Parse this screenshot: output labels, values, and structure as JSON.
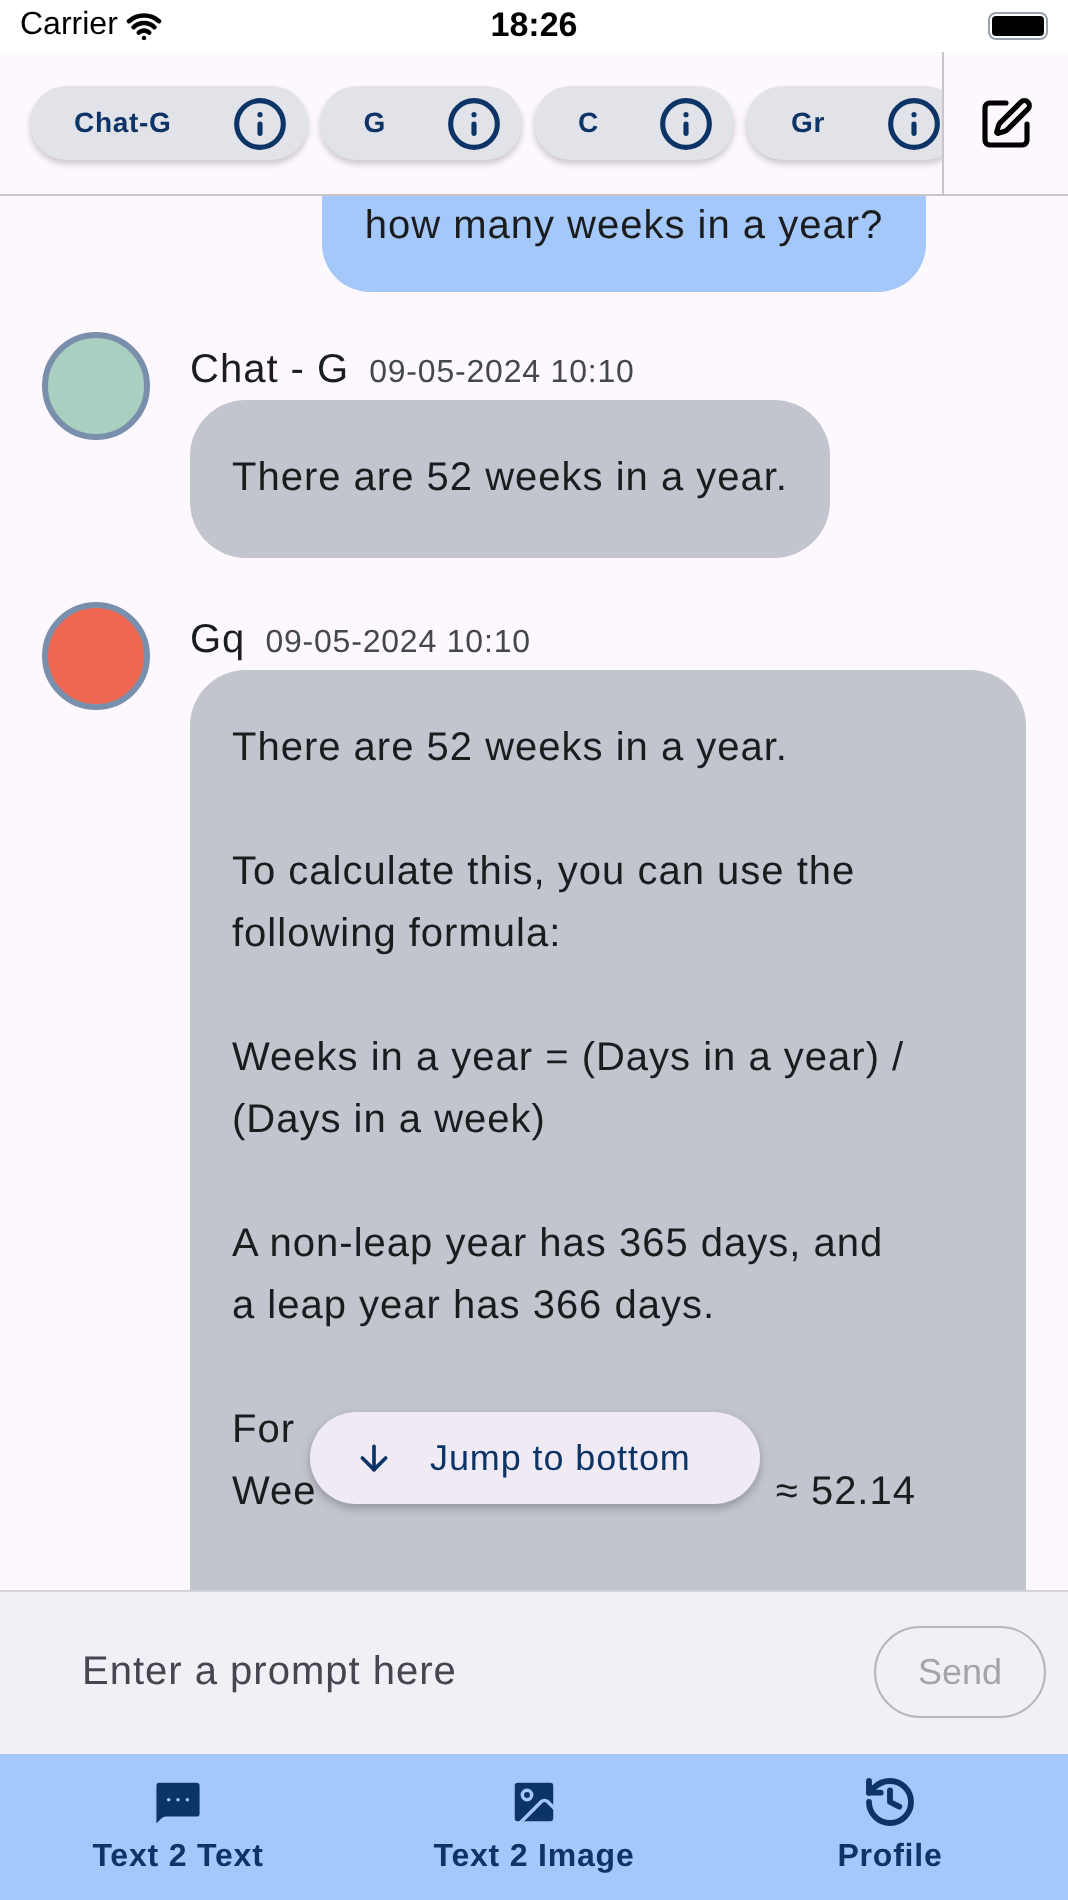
{
  "status_bar": {
    "carrier": "Carrier",
    "time": "18:26"
  },
  "models": [
    {
      "label": "Chat-G"
    },
    {
      "label": "G"
    },
    {
      "label": "C"
    },
    {
      "label": "Gr"
    }
  ],
  "messages": [
    {
      "kind": "user",
      "text": "how many weeks in a year?"
    },
    {
      "kind": "bot",
      "name": "Chat - G",
      "time": "09-05-2024 10:10",
      "color": "#a9cfc0",
      "paragraphs": [
        [
          "There are 52 weeks in a year."
        ]
      ]
    },
    {
      "kind": "bot",
      "name": "Gq",
      "time": "09-05-2024 10:10",
      "color": "#ee6650",
      "paragraphs": [
        [
          "There are 52 weeks in a year."
        ],
        [
          "To calculate this, you can use the",
          "following formula:"
        ],
        [
          "Weeks in a year = (Days in a year) /",
          "(Days in a week)"
        ],
        [
          "A non-leap year has 365 days, and",
          "a leap year has 366 days."
        ]
      ],
      "covered_lines": [
        {
          "left": "For"
        },
        {
          "left": "Wee",
          "right": "≈ 52.14"
        }
      ]
    }
  ],
  "jump_button": "Jump to bottom",
  "prompt": {
    "placeholder": "Enter a prompt here",
    "send": "Send"
  },
  "nav": [
    {
      "label": "Text 2 Text",
      "kind": "chat"
    },
    {
      "label": "Text 2 Image",
      "kind": "image"
    },
    {
      "label": "Profile",
      "kind": "history"
    }
  ]
}
